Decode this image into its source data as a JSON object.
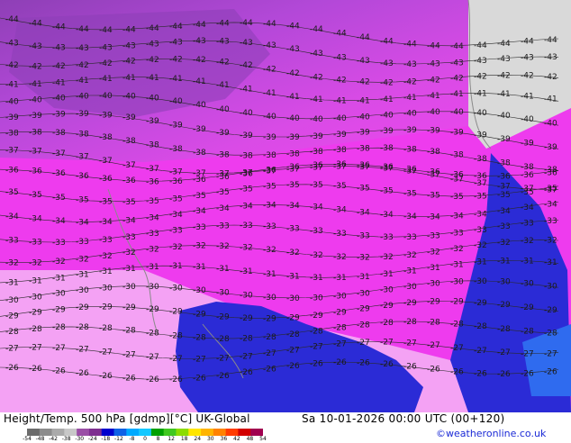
{
  "footer": {
    "title_left": "Height/Temp. 500 hPa [gdmp][°C] UK-Global",
    "title_right": "Sa 10-01-2026 00:00 UTC (00+120)",
    "credit": "©weatheronline.co.uk"
  },
  "colorbar": {
    "labels": [
      "-54",
      "-48",
      "-42",
      "-38",
      "-30",
      "-24",
      "-18",
      "-12",
      "-8",
      "0",
      "8",
      "12",
      "18",
      "24",
      "30",
      "36",
      "42",
      "48",
      "54"
    ],
    "colors": [
      "#6c6c6c",
      "#8c8c8c",
      "#aaaaaa",
      "#c8c8c8",
      "#9a4fa6",
      "#7e2f90",
      "#0000cd",
      "#0f62e6",
      "#00aaff",
      "#14c8ff",
      "#00a000",
      "#40c820",
      "#8cdc00",
      "#ffe600",
      "#ffb400",
      "#ff8200",
      "#ff3c00",
      "#d20000",
      "#a00050"
    ]
  },
  "colors": {
    "land": "#d9d9d9",
    "ocean_magenta": "#ee3bee",
    "ocean_violet": "#b84de0",
    "cold_blue": "#2b2bd6",
    "light_pink": "#f4a2f4",
    "contour": "#2a2a2a",
    "coast": "#8a8a8a"
  },
  "map": {
    "contour_values": [
      -44,
      -43,
      -42,
      -41,
      -40,
      -39,
      -38,
      -37,
      -36,
      -35,
      -34,
      -33,
      -32,
      -31,
      -30,
      -29,
      -28,
      -27,
      -26
    ]
  }
}
